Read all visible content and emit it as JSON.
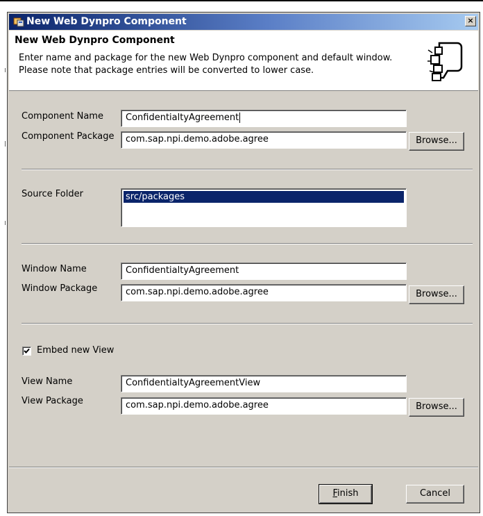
{
  "window": {
    "title": "New Web Dynpro Component",
    "close_glyph": "×"
  },
  "header": {
    "title": "New Web Dynpro Component",
    "description_line1": "Enter name and package for the new Web Dynpro component and default window.",
    "description_line2": "Please note that package entries will be converted to lower case.",
    "icon": "wizard-puzzle-icon"
  },
  "component": {
    "name_label": "Component Name",
    "name_value": "ConfidentialtyAgreement",
    "package_label": "Component Package",
    "package_value": "com.sap.npi.demo.adobe.agree",
    "browse_label": "Browse..."
  },
  "source": {
    "label": "Source Folder",
    "items": [
      "src/packages"
    ]
  },
  "window_section": {
    "name_label": "Window Name",
    "name_value": "ConfidentialtyAgreement",
    "package_label": "Window Package",
    "package_value": "com.sap.npi.demo.adobe.agree",
    "browse_label": "Browse..."
  },
  "view_section": {
    "embed_label": "Embed new View",
    "embed_checked": true,
    "name_label": "View Name",
    "name_value": "ConfidentialtyAgreementView",
    "package_label": "View Package",
    "package_value": "com.sap.npi.demo.adobe.agree",
    "browse_label": "Browse..."
  },
  "buttons": {
    "finish_mnemonic": "F",
    "finish_rest": "inish",
    "cancel": "Cancel"
  },
  "colors": {
    "titlebar_start": "#0a246a",
    "titlebar_end": "#a6caf0",
    "dialog_bg": "#d4d0c8",
    "selection": "#0a246a"
  }
}
